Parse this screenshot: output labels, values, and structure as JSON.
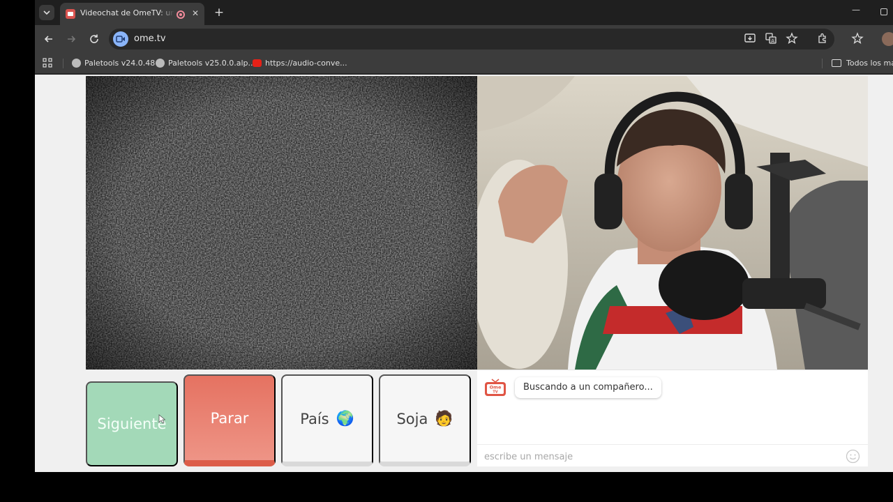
{
  "browser": {
    "tab_title": "Videochat de OmeTV: una alternativa",
    "url": "ome.tv",
    "bookmarks": [
      {
        "label": "Paletools v24.0.48",
        "icon": "globe-icon"
      },
      {
        "label": "Paletools v25.0.0.alp...",
        "icon": "globe-icon"
      },
      {
        "label": "https://audio-conve...",
        "icon": "youtube-icon"
      }
    ],
    "all_bookmarks_label": "Todos los mar"
  },
  "controls": {
    "next_label": "Siguiente",
    "stop_label": "Parar",
    "country_label": "País",
    "country_emoji": "🌍",
    "gender_label": "Soja",
    "gender_emoji": "🧑"
  },
  "chat": {
    "logo_text_top": "Ome",
    "logo_text_bottom": "TV",
    "status_message": "Buscando a un compañero...",
    "input_placeholder": "escribe un mensaje"
  },
  "colors": {
    "next_button": "#a3d9b8",
    "stop_button": "#e57261",
    "page_background": "#f0f0f0"
  }
}
